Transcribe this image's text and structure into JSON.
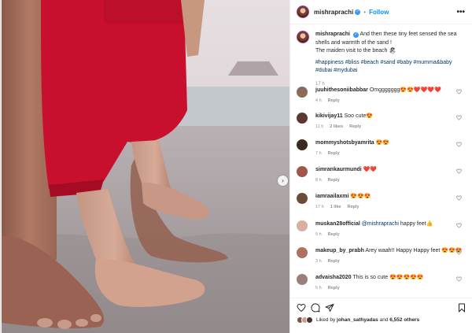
{
  "post": {
    "author": "mishraprachi",
    "follow_label": "Follow",
    "more_label": "•••",
    "next_label": "›",
    "verified_mark": "✓"
  },
  "caption": {
    "user": "mishraprachi",
    "text": "And then these tiny feet sensed the sea shells and warmth of the sand !",
    "line2": "The maiden visit to the beach 🏖",
    "tags": "#happiness #bliss #beach #sand #baby #mumma&baby #dubai #mydubai",
    "time": "17 h"
  },
  "comments": [
    {
      "user": "juuhithesoniibabbar",
      "mention": "",
      "text": "Omggggggg😍😍❤️❤️❤️❤️",
      "time": "4 h",
      "likes": "",
      "reply": "Reply",
      "avatar_color": "#8a6a58"
    },
    {
      "user": "kikivijay11",
      "mention": "",
      "text": "Soo cute😍",
      "time": "11 h",
      "likes": "2 likes",
      "reply": "Reply",
      "avatar_color": "#5a3a30"
    },
    {
      "user": "mommyshotsbyamrita",
      "mention": "",
      "text": "😍😍",
      "time": "7 h",
      "likes": "",
      "reply": "Reply",
      "avatar_color": "#3a2a22"
    },
    {
      "user": "simrankaurmundi",
      "mention": "",
      "text": "❤️❤️",
      "time": "8 h",
      "likes": "",
      "reply": "Reply",
      "avatar_color": "#a0564a"
    },
    {
      "user": "iamraailaxmi",
      "mention": "",
      "text": "😍😍😍",
      "time": "17 h",
      "likes": "1 like",
      "reply": "Reply",
      "avatar_color": "#6b4b3a"
    },
    {
      "user": "muskan28official",
      "mention": "@mishraprachi",
      "text": "happy feet👍",
      "time": "9 h",
      "likes": "",
      "reply": "Reply",
      "avatar_color": "#d8b0a0"
    },
    {
      "user": "makeup_by_prabh",
      "mention": "",
      "text": "Arey waah!! Happy Happy feet 😍😍😍",
      "time": "3 h",
      "likes": "",
      "reply": "Reply",
      "avatar_color": "#b07060"
    },
    {
      "user": "advaisha2020",
      "mention": "",
      "text": "This is so cute 😍😍😍😍😍",
      "time": "5 h",
      "likes": "",
      "reply": "Reply",
      "avatar_color": "#9a8078"
    }
  ],
  "likes_bar": {
    "prefix": "Liked by",
    "user": "johan_sathyadas",
    "middle": "and",
    "others": "6,552 others"
  },
  "colors": {
    "link": "#0095f6",
    "hashtag": "#00376b",
    "muted": "#8e8e8e",
    "shorts_red": "#c8102e"
  }
}
